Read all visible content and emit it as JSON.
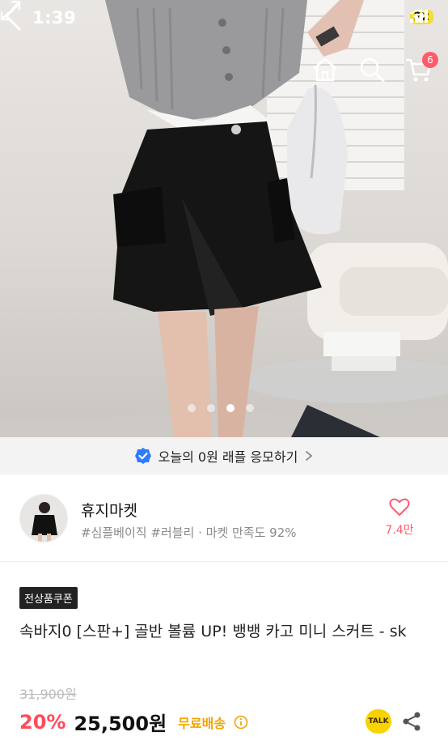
{
  "status": {
    "time": "1:39",
    "battery": "22"
  },
  "header": {
    "cart_count": "6"
  },
  "gallery": {
    "page_count": 4,
    "active_index": 2
  },
  "promo": {
    "text": "오늘의 0원 래플 응모하기"
  },
  "seller": {
    "name": "휴지마켓",
    "tags": "#심플베이직 #러블리 · 마켓 만족도 92%",
    "likes": "7.4만"
  },
  "product": {
    "coupon_badge": "전상품쿠폰",
    "title": "속바지0 [스판+] 골반 볼륨 UP! 뱅뱅 카고 미니 스커트 - sk",
    "original_price": "31,900원",
    "discount": "20%",
    "price": "25,500원",
    "shipping": "무료배송",
    "talk_label": "TALK"
  },
  "colors": {
    "accent": "#ff4b5a",
    "shipping": "#f0a500",
    "verified": "#2f7bff",
    "talk": "#f7d400"
  }
}
